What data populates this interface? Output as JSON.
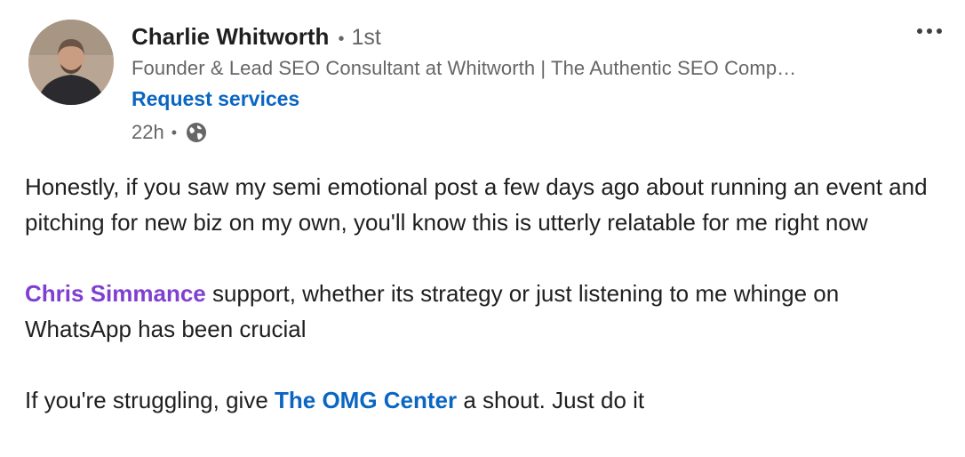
{
  "author": {
    "name": "Charlie Whitworth",
    "degree": "1st",
    "headline": "Founder & Lead SEO Consultant at Whitworth | The Authentic SEO Comp…",
    "cta_label": "Request services",
    "time": "22h",
    "separator": "•"
  },
  "post": {
    "p1": "Honestly, if you saw my semi emotional post a few days ago about running an event and pitching for new biz on my own, you'll know this is utterly relatable for me right now",
    "p2_mention": "Chris Simmance",
    "p2_text": " support, whether its strategy or just listening to me whinge on WhatsApp has been crucial",
    "p3_before": "If you're struggling, give ",
    "p3_mention": "The OMG Center",
    "p3_after": " a shout. Just do it"
  },
  "icons": {
    "globe": "globe-icon",
    "more": "more-options-icon"
  },
  "colors": {
    "link_blue": "#0a66c2",
    "mention_purple": "#7f3fd1",
    "secondary_text": "#666666"
  }
}
